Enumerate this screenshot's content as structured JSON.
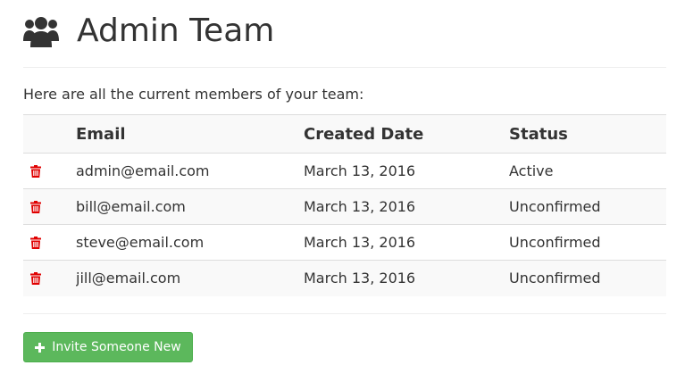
{
  "header": {
    "icon": "users-icon",
    "title": "Admin Team"
  },
  "intro_text": "Here are all the current members of your team:",
  "table": {
    "columns": [
      "Email",
      "Created Date",
      "Status"
    ],
    "rows": [
      {
        "email": "admin@email.com",
        "created": "March 13, 2016",
        "status": "Active",
        "action_icon": "trash-icon"
      },
      {
        "email": "bill@email.com",
        "created": "March 13, 2016",
        "status": "Unconfirmed",
        "action_icon": "trash-icon"
      },
      {
        "email": "steve@email.com",
        "created": "March 13, 2016",
        "status": "Unconfirmed",
        "action_icon": "trash-icon"
      },
      {
        "email": "jill@email.com",
        "created": "March 13, 2016",
        "status": "Unconfirmed",
        "action_icon": "trash-icon"
      }
    ]
  },
  "invite_button": {
    "icon": "plus-icon",
    "label": "Invite Someone New"
  },
  "colors": {
    "text": "#333333",
    "delete_icon": "#e00000",
    "invite_button": "#5cb85c",
    "stripe": "#f9f9f9"
  }
}
